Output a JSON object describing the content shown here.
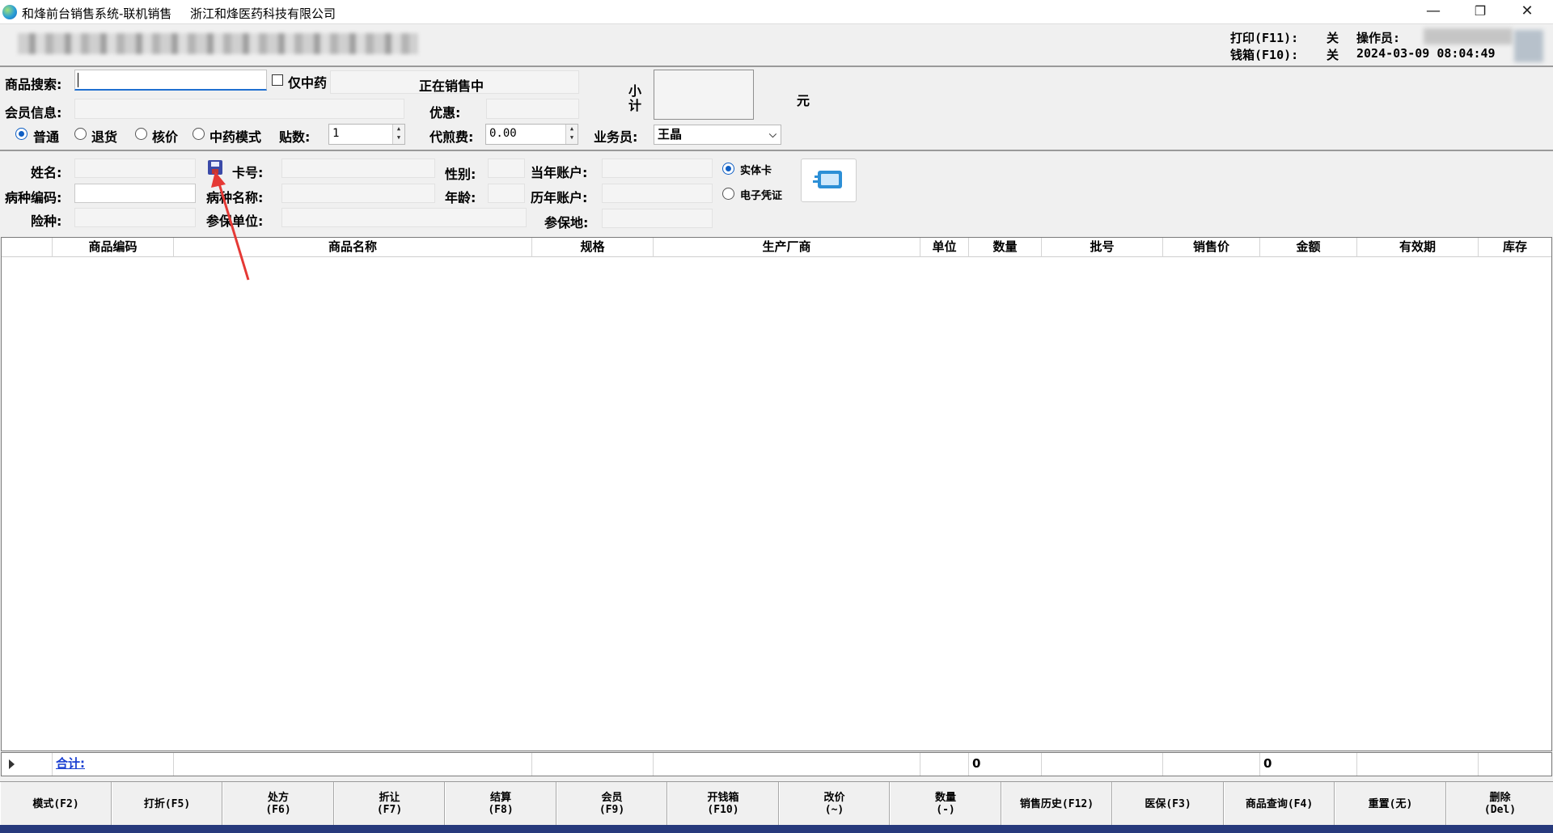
{
  "window": {
    "app_title": "和烽前台销售系统-联机销售",
    "company": "浙江和烽医药科技有限公司",
    "minimize": "—",
    "restore": "❐",
    "close": "✕"
  },
  "header": {
    "print_label": "打印(F11):",
    "print_value": "关",
    "cashbox_label": "钱箱(F10):",
    "cashbox_value": "关",
    "operator_label": "操作员:",
    "datetime": "2024-03-09 08:04:49"
  },
  "sale_form": {
    "search_label": "商品搜索:",
    "search_value": "",
    "only_tcm_label": "仅中药",
    "status_text": "正在销售中",
    "subtotal_label": "小计",
    "subtotal_value": "",
    "yuan_label": "元",
    "member_label": "会员信息:",
    "member_value": "",
    "discount_label": "优惠:",
    "discount_value": "",
    "modes": [
      {
        "label": "普通",
        "selected": true
      },
      {
        "label": "退货",
        "selected": false
      },
      {
        "label": "核价",
        "selected": false
      },
      {
        "label": "中药模式",
        "selected": false
      }
    ],
    "doses_label": "贴数:",
    "doses_value": "1",
    "decoct_label": "代煎费:",
    "decoct_value": "0.00",
    "salesman_label": "业务员:",
    "salesman_value": "王晶"
  },
  "insurance": {
    "name_label": "姓名:",
    "card_no_label": "卡号:",
    "gender_label": "性别:",
    "current_account_label": "当年账户:",
    "disease_code_label": "病种编码:",
    "disease_name_label": "病种名称:",
    "age_label": "年龄:",
    "history_account_label": "历年账户:",
    "insurance_type_label": "险种:",
    "insured_unit_label": "参保单位:",
    "insured_place_label": "参保地:",
    "card_options": [
      {
        "label": "实体卡",
        "selected": true
      },
      {
        "label": "电子凭证",
        "selected": false
      }
    ]
  },
  "grid": {
    "columns": [
      "",
      "商品编码",
      "商品名称",
      "规格",
      "生产厂商",
      "单位",
      "数量",
      "批号",
      "销售价",
      "金额",
      "有效期",
      "库存"
    ]
  },
  "totals": {
    "label": "合计:",
    "quantity": "0",
    "amount": "0"
  },
  "function_buttons": [
    {
      "line1": "模式(F2)",
      "line2": ""
    },
    {
      "line1": "打折(F5)",
      "line2": ""
    },
    {
      "line1": "处方",
      "line2": "(F6)"
    },
    {
      "line1": "折让",
      "line2": "(F7)"
    },
    {
      "line1": "结算",
      "line2": "(F8)"
    },
    {
      "line1": "会员",
      "line2": "(F9)"
    },
    {
      "line1": "开钱箱",
      "line2": "(F10)"
    },
    {
      "line1": "改价",
      "line2": "(~)"
    },
    {
      "line1": "数量",
      "line2": "(-)"
    },
    {
      "line1": "销售历史(F12)",
      "line2": ""
    },
    {
      "line1": "医保(F3)",
      "line2": ""
    },
    {
      "line1": "商品查询(F4)",
      "line2": ""
    },
    {
      "line1": "重置(无)",
      "line2": ""
    },
    {
      "line1": "删除",
      "line2": "(Del)"
    }
  ],
  "colors": {
    "accent": "#0f5fc4",
    "annotation_arrow": "#e53935",
    "bottom_strip": "#273a7c"
  }
}
